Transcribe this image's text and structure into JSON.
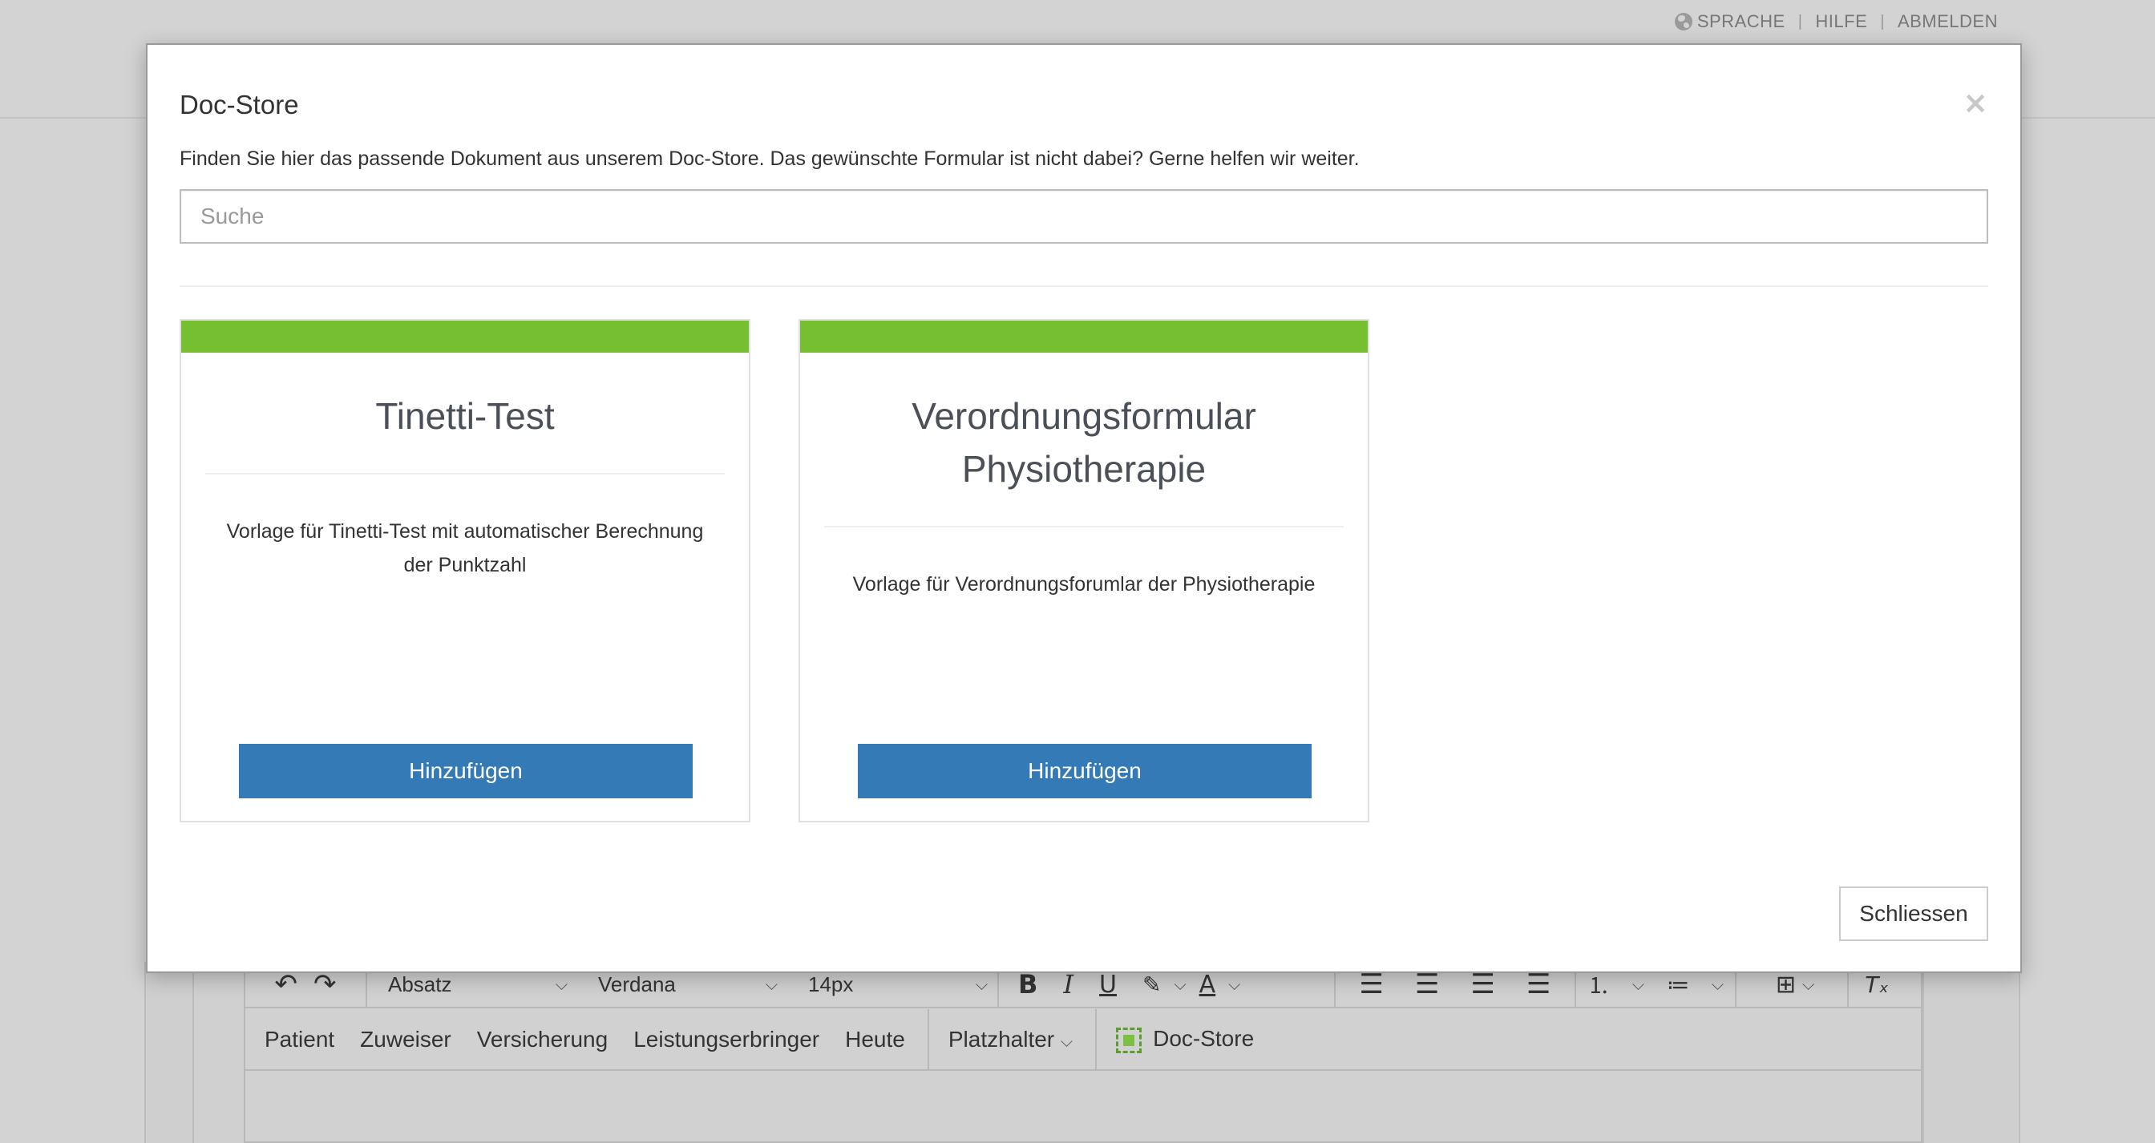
{
  "topnav": {
    "language": "SPRACHE",
    "help": "HILFE",
    "logout": "ABMELDEN",
    "separator": "|"
  },
  "editor": {
    "undo_icon": "undo-icon",
    "redo_icon": "redo-icon",
    "format_select": "Absatz",
    "font_select": "Verdana",
    "size_select": "14px",
    "bold": "B",
    "italic": "I",
    "underline": "U",
    "font_color": "A",
    "placeholders": [
      "Patient",
      "Zuweiser",
      "Versicherung",
      "Leistungserbringer",
      "Heute"
    ],
    "placeholder_menu": "Platzhalter",
    "docstore": "Doc-Store"
  },
  "modal": {
    "title": "Doc-Store",
    "close_symbol": "×",
    "description": "Finden Sie hier das passende Dokument aus unserem Doc-Store. Das gewünschte Formular ist nicht dabei? Gerne helfen wir weiter.",
    "search_placeholder": "Suche",
    "search_value": "",
    "cards": [
      {
        "title": "Tinetti-Test",
        "description": "Vorlage für Tinetti-Test mit automatischer Berechnung der Punktzahl",
        "button": "Hinzufügen"
      },
      {
        "title": "Verordnungsformular Physiotherapie",
        "description": "Vorlage für Verordnungsforumlar der Physiotherapie",
        "button": "Hinzufügen"
      }
    ],
    "close_button": "Schliessen"
  },
  "colors": {
    "card_accent": "#76bf30",
    "primary_button": "#337ab7",
    "overlay": "#d3d3d3"
  }
}
